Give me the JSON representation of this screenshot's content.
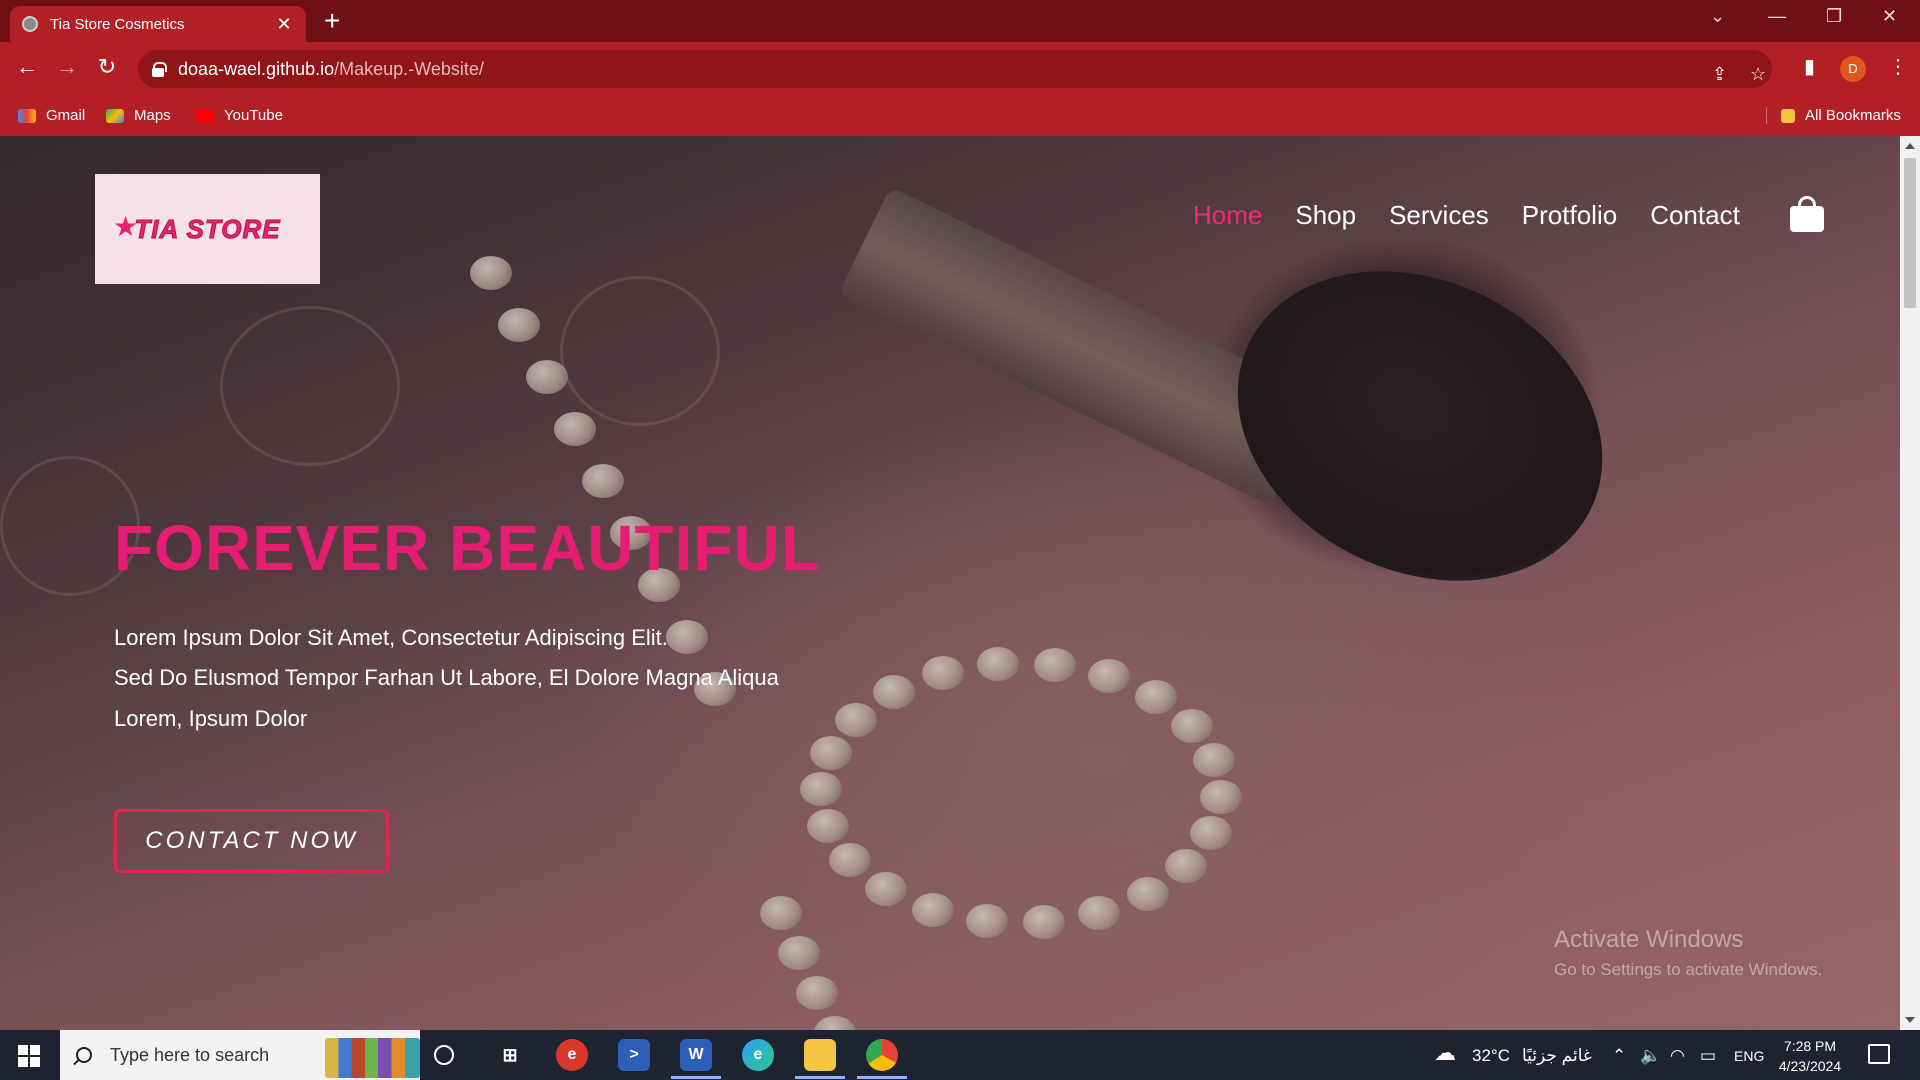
{
  "browser": {
    "tab_title": "Tia Store Cosmetics",
    "tab_close": "✕",
    "new_tab": "+",
    "url_domain": "doaa-wael.github.io",
    "url_path": "/Makeup.-Website/",
    "profile_initial": "D",
    "bookmarks": [
      {
        "label": "Gmail"
      },
      {
        "label": "Maps"
      },
      {
        "label": "YouTube"
      }
    ],
    "all_bookmarks": "All Bookmarks",
    "accent": "#b21f24"
  },
  "site": {
    "logo_text": "TIA STORE",
    "nav": [
      {
        "label": "Home",
        "active": true
      },
      {
        "label": "Shop"
      },
      {
        "label": "Services"
      },
      {
        "label": "Protfolio"
      },
      {
        "label": "Contact"
      }
    ],
    "hero": {
      "title": "FOREVER BEAUTIFUL",
      "lines": [
        "Lorem Ipsum Dolor Sit Amet, Consectetur Adipiscing Elit.",
        "Sed Do Elusmod Tempor Farhan Ut Labore, El Dolore Magna Aliqua",
        "Lorem, Ipsum Dolor"
      ],
      "cta": "CONTACT NOW"
    },
    "accent": "#e51d73"
  },
  "watermark": {
    "line1": "Activate Windows",
    "line2": "Go to Settings to activate Windows."
  },
  "taskbar": {
    "search_placeholder": "Type here to search",
    "weather": "32°C",
    "weather_desc": "غائم جزئيًا",
    "language": "ENG",
    "time": "7:28 PM",
    "date": "4/23/2024"
  }
}
